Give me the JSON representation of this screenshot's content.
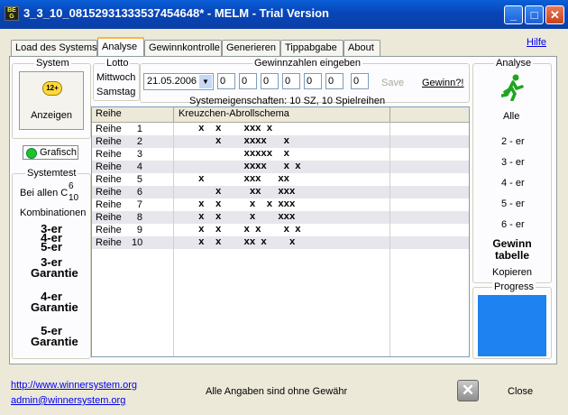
{
  "window": {
    "title": "3_3_10_08152931333537454648* - MELM - Trial Version",
    "app_icon_text": "BE G"
  },
  "tabs": [
    "Load des Systems",
    "Analyse",
    "Gewinnkontrolle",
    "Generieren",
    "Tippabgabe",
    "About"
  ],
  "active_tab": 1,
  "help_link": "Hilfe",
  "system_box": {
    "title": "System",
    "show_label": "Anzeigen",
    "grafisch_label": "Grafisch"
  },
  "systemtest": {
    "title": "Systemtest",
    "line1": "Bei allen C",
    "sup": "6",
    "sub": "10",
    "line2": "Kombinationen",
    "items": [
      "3-er",
      "4-er",
      "5-er",
      "3-er Garantie",
      "4-er Garantie",
      "5-er Garantie"
    ]
  },
  "lotto": {
    "title": "Lotto",
    "day1": "Mittwoch",
    "day2": "Samstag",
    "date": "21.05.2006"
  },
  "gewinnzahlen": {
    "title": "Gewinnzahlen eingeben",
    "values": [
      "0",
      "0",
      "0",
      "0",
      "0",
      "0",
      "0"
    ],
    "save_label": "Save",
    "gewinn_label": "Gewinn?!"
  },
  "system_properties": "Systemeigenschaften: 10 SZ, 10 Spielreihen",
  "grid": {
    "col1_header": "Reihe",
    "col2_header": "Kreuzchen-Abrollschema",
    "rows": [
      {
        "label": "Reihe",
        "num": "1",
        "marks": [
          [
            0,
            0
          ],
          [
            1,
            0
          ],
          [
            3,
            0
          ],
          [
            4,
            0
          ],
          [
            5,
            0
          ],
          [
            6,
            0
          ]
        ]
      },
      {
        "label": "Reihe",
        "num": "2",
        "marks": [
          [
            1,
            0
          ],
          [
            3,
            0
          ],
          [
            4,
            0
          ],
          [
            5,
            0
          ],
          [
            6,
            0
          ],
          [
            7,
            0
          ]
        ]
      },
      {
        "label": "Reihe",
        "num": "3",
        "marks": [
          [
            2,
            0
          ],
          [
            3,
            0
          ],
          [
            4,
            0
          ],
          [
            5,
            0
          ],
          [
            6,
            0
          ],
          [
            7,
            0
          ]
        ]
      },
      {
        "label": "Reihe",
        "num": "4",
        "marks": [
          [
            2,
            0
          ],
          [
            3,
            0
          ],
          [
            4,
            0
          ],
          [
            5,
            0
          ],
          [
            6,
            0
          ],
          [
            7,
            0
          ]
        ]
      },
      {
        "label": "Reihe",
        "num": "5",
        "marks": [
          [
            0,
            0
          ],
          [
            3,
            0
          ],
          [
            4,
            0
          ],
          [
            5,
            0
          ],
          [
            6,
            0
          ],
          [
            7,
            0
          ]
        ]
      },
      {
        "label": "Reihe",
        "num": "6",
        "marks": [
          [
            1,
            0
          ],
          [
            4,
            0
          ],
          [
            5,
            0
          ],
          [
            6,
            0
          ],
          [
            7,
            0
          ],
          [
            8,
            0
          ]
        ]
      },
      {
        "label": "Reihe",
        "num": "7",
        "marks": [
          [
            0,
            0
          ],
          [
            2,
            0
          ],
          [
            4,
            0
          ],
          [
            6,
            0
          ],
          [
            7,
            0
          ],
          [
            8,
            0
          ]
        ]
      },
      {
        "label": "Reihe",
        "num": "8",
        "marks": [
          [
            0,
            0
          ],
          [
            1,
            0
          ],
          [
            3,
            0
          ],
          [
            6,
            0
          ],
          [
            7,
            0
          ],
          [
            8,
            0
          ]
        ]
      },
      {
        "label": "Reihe",
        "num": "9",
        "marks": [
          [
            0,
            0
          ],
          [
            1,
            0
          ],
          [
            3,
            0
          ],
          [
            4,
            0
          ],
          [
            7,
            0
          ],
          [
            8,
            0
          ]
        ]
      },
      {
        "label": "Reihe",
        "num": "10",
        "marks": [
          [
            0,
            0
          ],
          [
            1,
            0
          ],
          [
            3,
            0
          ],
          [
            4,
            0
          ],
          [
            5,
            0
          ],
          [
            7,
            0
          ]
        ]
      }
    ],
    "row_marks_text": [
      "x  x    xxx x",
      "   x    xxxx   x",
      "        xxxxx  x",
      "        xxxx   x x",
      "x       xxx   xx",
      "   x     xx   xxx",
      "x  x     x  x xxx",
      "x  x     x    xxx",
      "x  x    x x    x x",
      "x  x    xx x    x"
    ]
  },
  "analyse": {
    "title": "Analyse",
    "alle_label": "Alle",
    "items": [
      "2 - er",
      "3 - er",
      "4 - er",
      "5 - er",
      "6 - er"
    ],
    "gewinn_tabelle": [
      "Gewinn",
      "tabelle"
    ],
    "kopieren": "Kopieren",
    "progress_label": "Progress",
    "progress_color": "#1e82f0"
  },
  "footer": {
    "url": "http://www.winnersystem.org",
    "email": "admin@winnersystem.org",
    "disclaimer": "Alle Angaben sind ohne Gewähr",
    "close_label": "Close"
  }
}
